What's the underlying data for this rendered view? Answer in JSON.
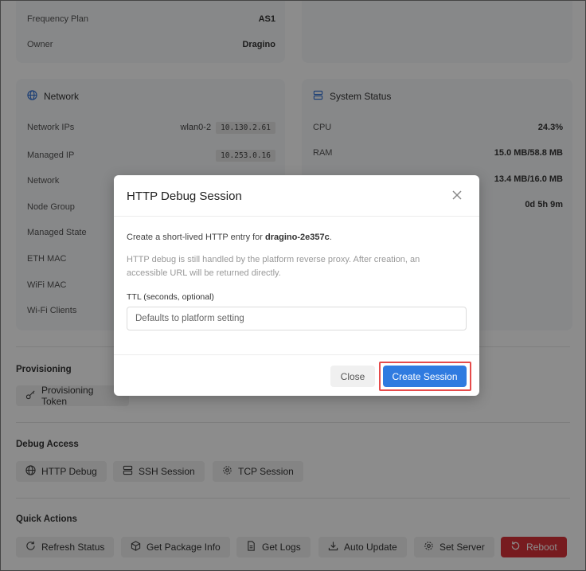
{
  "top_card": {
    "rows": [
      {
        "label": "Frequency Plan",
        "value": "AS1"
      },
      {
        "label": "Owner",
        "value": "Dragino"
      }
    ]
  },
  "network_card": {
    "title": "Network",
    "rows": [
      {
        "label": "Network IPs",
        "prefix": "wlan0-2",
        "value": "10.130.2.61"
      },
      {
        "label": "Managed IP",
        "value": "10.253.0.16"
      },
      {
        "label": "Network"
      },
      {
        "label": "Node Group"
      },
      {
        "label": "Managed State"
      },
      {
        "label": "ETH MAC"
      },
      {
        "label": "WiFi MAC"
      },
      {
        "label": "Wi-Fi Clients"
      }
    ]
  },
  "system_card": {
    "title": "System Status",
    "rows": [
      {
        "label": "CPU",
        "value": "24.3%"
      },
      {
        "label": "RAM",
        "value": "15.0 MB/58.8 MB"
      },
      {
        "value": "13.4 MB/16.0 MB"
      },
      {
        "value": "0d 5h 9m"
      }
    ]
  },
  "provisioning": {
    "title": "Provisioning",
    "token_button": "Provisioning Token"
  },
  "debug_access": {
    "title": "Debug Access",
    "buttons": [
      "HTTP Debug",
      "SSH Session",
      "TCP Session"
    ]
  },
  "quick_actions": {
    "title": "Quick Actions",
    "buttons": [
      "Refresh Status",
      "Get Package Info",
      "Get Logs",
      "Auto Update",
      "Set Server",
      "Reboot"
    ]
  },
  "modal": {
    "title": "HTTP Debug Session",
    "intro_prefix": "Create a short-lived HTTP entry for ",
    "device": "dragino-2e357c",
    "intro_suffix": ".",
    "help": "HTTP debug is still handled by the platform reverse proxy. After creation, an accessible URL will be returned directly.",
    "ttl_label": "TTL (seconds, optional)",
    "ttl_placeholder": "Defaults to platform setting",
    "ttl_value": "",
    "close_button": "Close",
    "create_button": "Create Session"
  },
  "colors": {
    "primary": "#2f7be0",
    "danger": "#d9323a",
    "highlight": "#e64b4b"
  }
}
